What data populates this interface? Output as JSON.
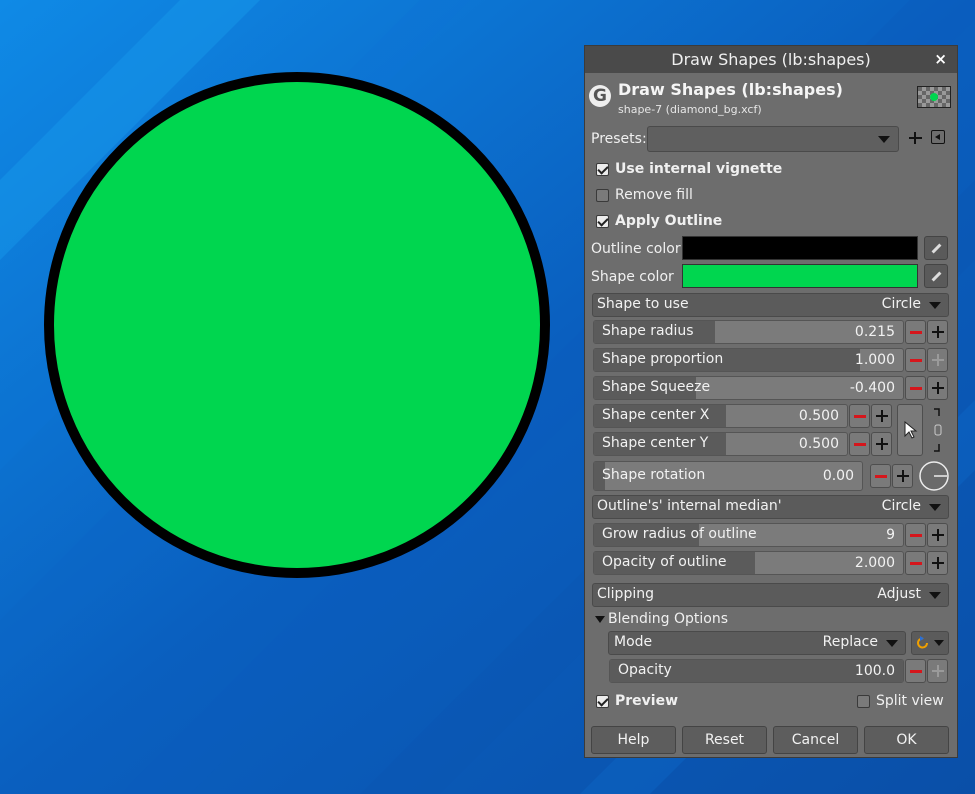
{
  "dialog": {
    "window_title": "Draw Shapes (lb:shapes)",
    "close_glyph": "×",
    "header_title": "Draw Shapes (lb:shapes)",
    "header_subtitle": "shape-7 (diamond_bg.xcf)",
    "presets_label": "Presets:",
    "presets_value": ""
  },
  "options": {
    "use_internal_vignette": {
      "label": "Use internal vignette",
      "checked": true
    },
    "remove_fill": {
      "label": "Remove fill",
      "checked": false
    },
    "apply_outline": {
      "label": "Apply Outline",
      "checked": true
    },
    "outline_color_label": "Outline color",
    "outline_color": "#000000",
    "shape_color_label": "Shape color",
    "shape_color": "#00d64f"
  },
  "shape_to_use": {
    "label": "Shape to use",
    "value": "Circle"
  },
  "sliders": {
    "shape_radius": {
      "label": "Shape radius",
      "value": "0.215",
      "fill": 0.35
    },
    "shape_proportion": {
      "label": "Shape proportion",
      "value": "1.000",
      "fill": 0.82
    },
    "shape_squeeze": {
      "label": "Shape Squeeze",
      "value": "-0.400",
      "fill": 0.3
    },
    "shape_center_x": {
      "label": "Shape center X",
      "value": "0.500",
      "fill": 0.52
    },
    "shape_center_y": {
      "label": "Shape center Y",
      "value": "0.500",
      "fill": 0.52
    },
    "shape_rotation": {
      "label": "Shape rotation",
      "value": "0.00",
      "fill": 0.04
    },
    "grow_radius": {
      "label": "Grow radius of outline",
      "value": "9",
      "fill": 0.34
    },
    "opacity_outline": {
      "label": "Opacity of outline",
      "value": "2.000",
      "fill": 0.52
    },
    "opacity": {
      "label": "Opacity",
      "value": "100.0",
      "fill": 1.0
    }
  },
  "outline_median": {
    "label": "Outline's' internal median'",
    "value": "Circle"
  },
  "clipping": {
    "label": "Clipping",
    "value": "Adjust"
  },
  "blending": {
    "expander_label": "Blending Options",
    "mode_label": "Mode",
    "mode_value": "Replace"
  },
  "preview": {
    "label": "Preview",
    "checked": true
  },
  "split_view": {
    "label": "Split view",
    "checked": false
  },
  "buttons": {
    "help": "Help",
    "reset": "Reset",
    "cancel": "Cancel",
    "ok": "OK"
  },
  "canvas": {
    "background_color": "#0a64c8",
    "shape_fill": "#00d64f",
    "shape_outline": "#000000"
  }
}
